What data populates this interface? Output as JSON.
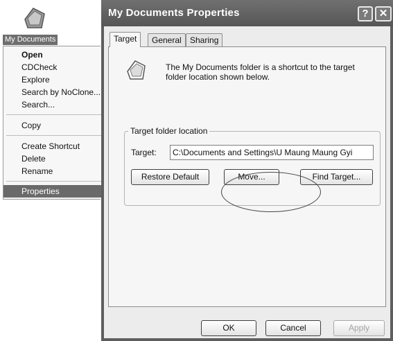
{
  "desktop": {
    "icon_name": "my-documents-folder-icon",
    "label": "My Documents"
  },
  "context_menu": {
    "items": [
      {
        "label": "Open"
      },
      {
        "label": "CDCheck"
      },
      {
        "label": "Explore"
      },
      {
        "label": "Search by NoClone..."
      },
      {
        "label": "Search..."
      },
      {
        "label": "Copy"
      },
      {
        "label": "Create Shortcut"
      },
      {
        "label": "Delete"
      },
      {
        "label": "Rename"
      },
      {
        "label": "Properties"
      }
    ]
  },
  "dialog": {
    "title": "My Documents Properties",
    "help_glyph": "?",
    "close_glyph": "✕",
    "tabs": [
      {
        "label": "Target"
      },
      {
        "label": "General"
      },
      {
        "label": "Sharing"
      }
    ],
    "description": "The My Documents folder is a shortcut to the target folder location shown below.",
    "group_label": "Target folder location",
    "target_label": "Target:",
    "target_value": "C:\\Documents and Settings\\U Maung Maung Gyi",
    "buttons": {
      "restore_default": "Restore Default",
      "move": "Move...",
      "find_target": "Find Target...",
      "ok": "OK",
      "cancel": "Cancel",
      "apply": "Apply"
    }
  }
}
